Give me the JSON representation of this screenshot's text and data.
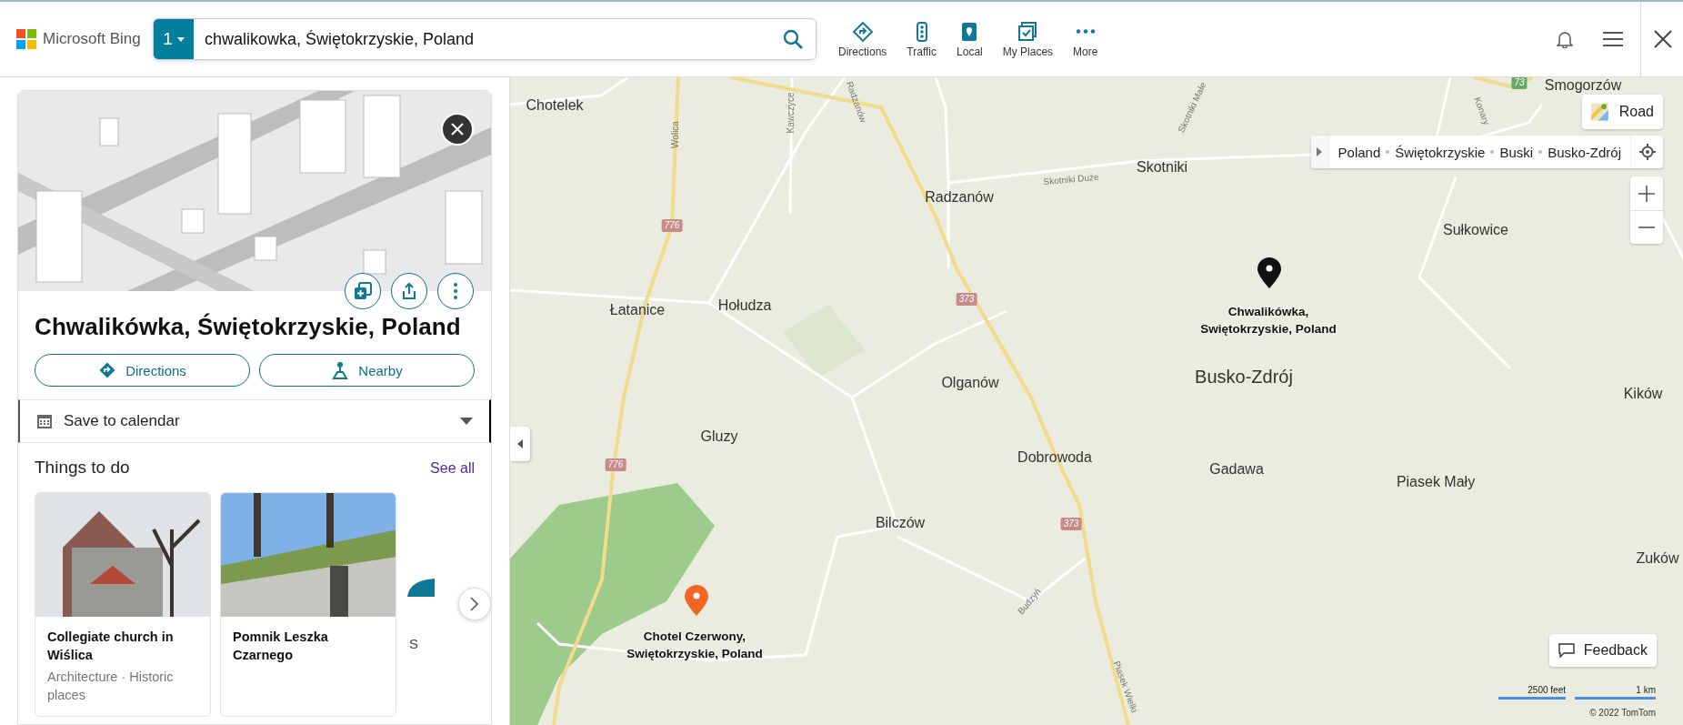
{
  "header": {
    "logo": "Microsoft Bing",
    "search": {
      "badge": "1",
      "value": "chwalikowka, Świętokrzyskie, Poland"
    },
    "nav": [
      {
        "label": "Directions",
        "kind": "directions"
      },
      {
        "label": "Traffic",
        "kind": "traffic"
      },
      {
        "label": "Local",
        "kind": "local"
      },
      {
        "label": "My Places",
        "kind": "places"
      },
      {
        "label": "More",
        "kind": "more"
      }
    ]
  },
  "panel": {
    "title": "Chwalikówka, Świętokrzyskie, Poland",
    "actions": [
      {
        "label": "Directions",
        "kind": "directions"
      },
      {
        "label": "Nearby",
        "kind": "nearby"
      }
    ],
    "calendar": {
      "label": "Save to calendar",
      "expanded": false
    },
    "things": {
      "heading": "Things to do",
      "see_all": "See all",
      "cards": [
        {
          "title": "Collegiate church in Wiślica",
          "subtitle": "Architecture · Historic places",
          "kind": "church"
        },
        {
          "title": "Pomnik Leszka Czarnego",
          "kind": "monument"
        },
        {
          "title": "S",
          "kind": "partial"
        }
      ]
    }
  },
  "map": {
    "places": [
      {
        "name": "Chotelek",
        "kind": "village"
      },
      {
        "name": "Radzanów",
        "kind": "village"
      },
      {
        "name": "Skotniki",
        "kind": "village"
      },
      {
        "name": "Smogorzów",
        "kind": "village"
      },
      {
        "name": "Sułkowice",
        "kind": "village"
      },
      {
        "name": "Łatanice",
        "kind": "village"
      },
      {
        "name": "Hołudza",
        "kind": "village"
      },
      {
        "name": "Olganów",
        "kind": "village"
      },
      {
        "name": "Busko-Zdrój",
        "kind": "city"
      },
      {
        "name": "Kików",
        "kind": "village"
      },
      {
        "name": "Gluzy",
        "kind": "village"
      },
      {
        "name": "Dobrowoda",
        "kind": "village"
      },
      {
        "name": "Gadawa",
        "kind": "village"
      },
      {
        "name": "Piasek Mały",
        "kind": "village"
      },
      {
        "name": "Bilczów",
        "kind": "village"
      },
      {
        "name": "Zuków",
        "kind": "village"
      }
    ],
    "streets": [
      "Wolica",
      "Kawczyce",
      "Radzanów",
      "Skotniki Małe",
      "Skotniki Duże",
      "Konary",
      "Budzyń",
      "Piasek Wielki"
    ],
    "shields": [
      "776",
      "776",
      "373",
      "373",
      "73"
    ],
    "pins": [
      {
        "label": "Chwalikówka,\nSwiętokrzyskie, Poland",
        "color": "#111111"
      },
      {
        "label": "Chotel Czerwony,\nSwiętokrzyskie, Poland",
        "color": "#f26522"
      }
    ],
    "style_button": "Road",
    "breadcrumb": [
      "Poland",
      "Świętokrzyskie",
      "Buski",
      "Busko-Zdrój"
    ],
    "feedback": "Feedback",
    "scale": [
      "2500 feet",
      "1 km"
    ],
    "copyright": "© 2022 TomTom"
  }
}
